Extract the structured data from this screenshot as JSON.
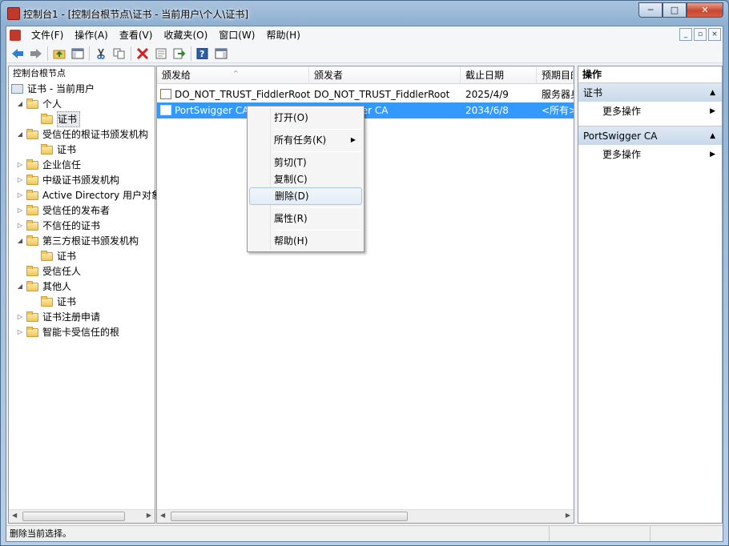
{
  "window": {
    "title": "控制台1 - [控制台根节点\\证书 - 当前用户\\个人\\证书]",
    "min": "─",
    "max": "□",
    "close": "✕"
  },
  "menu": {
    "items": [
      "文件(F)",
      "操作(A)",
      "查看(V)",
      "收藏夹(O)",
      "窗口(W)",
      "帮助(H)"
    ],
    "mdi": [
      "_",
      "▫",
      "×"
    ]
  },
  "toolbar": {
    "icons": [
      "back-icon",
      "forward-icon",
      "up-folder-icon",
      "show-hide-tree-icon",
      "cut-icon",
      "copy-icon",
      "delete-icon",
      "properties-icon",
      "export-icon",
      "help-icon",
      "show-hide-action-icon"
    ]
  },
  "tree": {
    "header": "控制台根节点",
    "nodes": [
      {
        "label": "证书 - 当前用户",
        "twisty": ""
      },
      {
        "label": "个人",
        "twisty": "◢"
      },
      {
        "label": "证书",
        "twisty": ""
      },
      {
        "label": "受信任的根证书颁发机构",
        "twisty": "◢"
      },
      {
        "label": "证书",
        "twisty": ""
      },
      {
        "label": "企业信任",
        "twisty": "▷"
      },
      {
        "label": "中级证书颁发机构",
        "twisty": "▷"
      },
      {
        "label": "Active Directory 用户对象",
        "twisty": "▷"
      },
      {
        "label": "受信任的发布者",
        "twisty": "▷"
      },
      {
        "label": "不信任的证书",
        "twisty": "▷"
      },
      {
        "label": "第三方根证书颁发机构",
        "twisty": "◢"
      },
      {
        "label": "证书",
        "twisty": ""
      },
      {
        "label": "受信任人",
        "twisty": ""
      },
      {
        "label": "其他人",
        "twisty": "◢"
      },
      {
        "label": "证书",
        "twisty": ""
      },
      {
        "label": "证书注册申请",
        "twisty": "▷"
      },
      {
        "label": "智能卡受信任的根",
        "twisty": "▷"
      }
    ]
  },
  "list": {
    "columns": [
      "颁发给",
      "颁发者",
      "截止日期",
      "预期目的"
    ],
    "sort_indicator": "^",
    "rows": [
      {
        "issued_to": "DO_NOT_TRUST_FiddlerRoot",
        "issuer": "DO_NOT_TRUST_FiddlerRoot",
        "expires": "2025/4/9",
        "purpose": "服务器身份验证"
      },
      {
        "issued_to": "PortSwigger CA",
        "issuer": "PortSwigger CA",
        "expires": "2034/6/8",
        "purpose": "<所有>"
      }
    ]
  },
  "actions": {
    "header": "操作",
    "sections": [
      {
        "title": "证书",
        "item": "更多操作"
      },
      {
        "title": "PortSwigger CA",
        "item": "更多操作"
      }
    ]
  },
  "context_menu": {
    "items": [
      "打开(O)",
      "所有任务(K)",
      "剪切(T)",
      "复制(C)",
      "删除(D)",
      "属性(R)",
      "帮助(H)"
    ],
    "highlighted": "删除(D)"
  },
  "status": {
    "text": "删除当前选择。"
  }
}
